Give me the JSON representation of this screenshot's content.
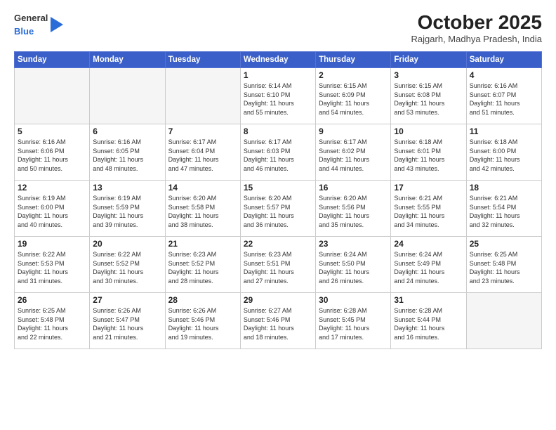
{
  "header": {
    "logo_general": "General",
    "logo_blue": "Blue",
    "month_title": "October 2025",
    "location": "Rajgarh, Madhya Pradesh, India"
  },
  "weekdays": [
    "Sunday",
    "Monday",
    "Tuesday",
    "Wednesday",
    "Thursday",
    "Friday",
    "Saturday"
  ],
  "weeks": [
    [
      {
        "day": "",
        "info": ""
      },
      {
        "day": "",
        "info": ""
      },
      {
        "day": "",
        "info": ""
      },
      {
        "day": "1",
        "info": "Sunrise: 6:14 AM\nSunset: 6:10 PM\nDaylight: 11 hours\nand 55 minutes."
      },
      {
        "day": "2",
        "info": "Sunrise: 6:15 AM\nSunset: 6:09 PM\nDaylight: 11 hours\nand 54 minutes."
      },
      {
        "day": "3",
        "info": "Sunrise: 6:15 AM\nSunset: 6:08 PM\nDaylight: 11 hours\nand 53 minutes."
      },
      {
        "day": "4",
        "info": "Sunrise: 6:16 AM\nSunset: 6:07 PM\nDaylight: 11 hours\nand 51 minutes."
      }
    ],
    [
      {
        "day": "5",
        "info": "Sunrise: 6:16 AM\nSunset: 6:06 PM\nDaylight: 11 hours\nand 50 minutes."
      },
      {
        "day": "6",
        "info": "Sunrise: 6:16 AM\nSunset: 6:05 PM\nDaylight: 11 hours\nand 48 minutes."
      },
      {
        "day": "7",
        "info": "Sunrise: 6:17 AM\nSunset: 6:04 PM\nDaylight: 11 hours\nand 47 minutes."
      },
      {
        "day": "8",
        "info": "Sunrise: 6:17 AM\nSunset: 6:03 PM\nDaylight: 11 hours\nand 46 minutes."
      },
      {
        "day": "9",
        "info": "Sunrise: 6:17 AM\nSunset: 6:02 PM\nDaylight: 11 hours\nand 44 minutes."
      },
      {
        "day": "10",
        "info": "Sunrise: 6:18 AM\nSunset: 6:01 PM\nDaylight: 11 hours\nand 43 minutes."
      },
      {
        "day": "11",
        "info": "Sunrise: 6:18 AM\nSunset: 6:00 PM\nDaylight: 11 hours\nand 42 minutes."
      }
    ],
    [
      {
        "day": "12",
        "info": "Sunrise: 6:19 AM\nSunset: 6:00 PM\nDaylight: 11 hours\nand 40 minutes."
      },
      {
        "day": "13",
        "info": "Sunrise: 6:19 AM\nSunset: 5:59 PM\nDaylight: 11 hours\nand 39 minutes."
      },
      {
        "day": "14",
        "info": "Sunrise: 6:20 AM\nSunset: 5:58 PM\nDaylight: 11 hours\nand 38 minutes."
      },
      {
        "day": "15",
        "info": "Sunrise: 6:20 AM\nSunset: 5:57 PM\nDaylight: 11 hours\nand 36 minutes."
      },
      {
        "day": "16",
        "info": "Sunrise: 6:20 AM\nSunset: 5:56 PM\nDaylight: 11 hours\nand 35 minutes."
      },
      {
        "day": "17",
        "info": "Sunrise: 6:21 AM\nSunset: 5:55 PM\nDaylight: 11 hours\nand 34 minutes."
      },
      {
        "day": "18",
        "info": "Sunrise: 6:21 AM\nSunset: 5:54 PM\nDaylight: 11 hours\nand 32 minutes."
      }
    ],
    [
      {
        "day": "19",
        "info": "Sunrise: 6:22 AM\nSunset: 5:53 PM\nDaylight: 11 hours\nand 31 minutes."
      },
      {
        "day": "20",
        "info": "Sunrise: 6:22 AM\nSunset: 5:52 PM\nDaylight: 11 hours\nand 30 minutes."
      },
      {
        "day": "21",
        "info": "Sunrise: 6:23 AM\nSunset: 5:52 PM\nDaylight: 11 hours\nand 28 minutes."
      },
      {
        "day": "22",
        "info": "Sunrise: 6:23 AM\nSunset: 5:51 PM\nDaylight: 11 hours\nand 27 minutes."
      },
      {
        "day": "23",
        "info": "Sunrise: 6:24 AM\nSunset: 5:50 PM\nDaylight: 11 hours\nand 26 minutes."
      },
      {
        "day": "24",
        "info": "Sunrise: 6:24 AM\nSunset: 5:49 PM\nDaylight: 11 hours\nand 24 minutes."
      },
      {
        "day": "25",
        "info": "Sunrise: 6:25 AM\nSunset: 5:48 PM\nDaylight: 11 hours\nand 23 minutes."
      }
    ],
    [
      {
        "day": "26",
        "info": "Sunrise: 6:25 AM\nSunset: 5:48 PM\nDaylight: 11 hours\nand 22 minutes."
      },
      {
        "day": "27",
        "info": "Sunrise: 6:26 AM\nSunset: 5:47 PM\nDaylight: 11 hours\nand 21 minutes."
      },
      {
        "day": "28",
        "info": "Sunrise: 6:26 AM\nSunset: 5:46 PM\nDaylight: 11 hours\nand 19 minutes."
      },
      {
        "day": "29",
        "info": "Sunrise: 6:27 AM\nSunset: 5:46 PM\nDaylight: 11 hours\nand 18 minutes."
      },
      {
        "day": "30",
        "info": "Sunrise: 6:28 AM\nSunset: 5:45 PM\nDaylight: 11 hours\nand 17 minutes."
      },
      {
        "day": "31",
        "info": "Sunrise: 6:28 AM\nSunset: 5:44 PM\nDaylight: 11 hours\nand 16 minutes."
      },
      {
        "day": "",
        "info": ""
      }
    ]
  ]
}
